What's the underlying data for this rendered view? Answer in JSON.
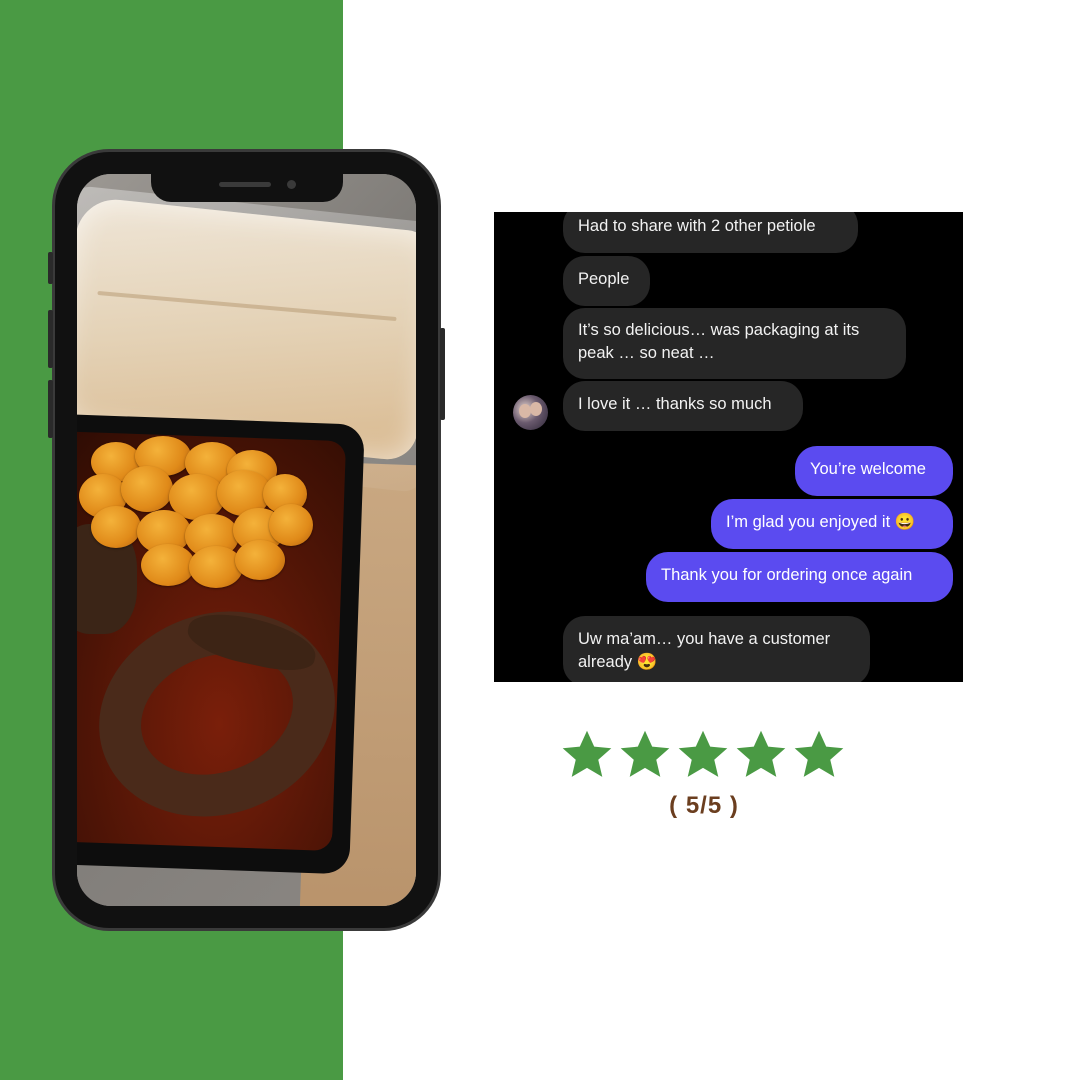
{
  "colors": {
    "brand_green": "#4a9a44",
    "chat_background": "#000000",
    "received_bubble": "#262626",
    "sent_bubble": "#5b4bf0",
    "star_color": "#4a9a44",
    "rating_text_color": "#6b3e1f"
  },
  "phone": {
    "photo_subject": "food-photo"
  },
  "chat": {
    "avatar_icon": "profile-avatar-icon",
    "messages": [
      {
        "direction": "received",
        "text": "Had to share with 2 other petiole"
      },
      {
        "direction": "received",
        "text": "People"
      },
      {
        "direction": "received",
        "text": "It’s so delicious… was packaging at its\npeak … so neat …"
      },
      {
        "direction": "received",
        "text": "I love it … thanks so much"
      },
      {
        "direction": "sent",
        "text": "You’re welcome"
      },
      {
        "direction": "sent",
        "text": "I’m glad you enjoyed it 😀"
      },
      {
        "direction": "sent",
        "text": "Thank you for ordering once again"
      },
      {
        "direction": "received",
        "text": "Uw ma’am… you have a customer\nalready 😍"
      }
    ]
  },
  "rating": {
    "stars_filled": 5,
    "stars_total": 5,
    "star_icon": "star-icon",
    "label": "( 5/5 )"
  }
}
